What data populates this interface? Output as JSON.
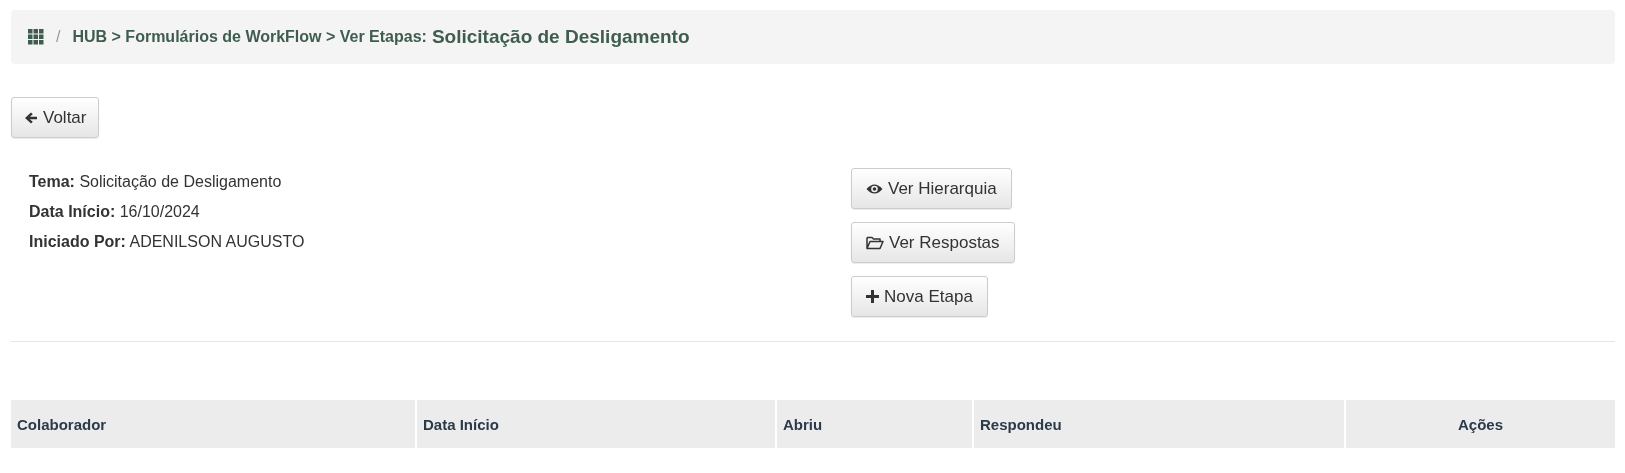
{
  "breadcrumb": {
    "separator": "/",
    "path": "HUB > Formulários de WorkFlow > Ver Etapas:",
    "title": "Solicitação de Desligamento"
  },
  "back_button": {
    "label": "Voltar"
  },
  "info": [
    "**Tema:** Solicitação de Desligamento",
    "**Data Início:** 16/10/2024",
    "**Iniciado Por:** ADENILSON AUGUSTO"
  ],
  "actions": [
    {
      "kind": "eye",
      "label": "Ver Hierarquia"
    },
    {
      "kind": "folder",
      "label": "Ver Respostas"
    },
    {
      "kind": "plus",
      "label": "Nova Etapa"
    }
  ],
  "table": {
    "columns": [
      {
        "label": "Colaborador"
      },
      {
        "label": "Data Início"
      },
      {
        "label": "Abriu"
      },
      {
        "label": "Respondeu"
      },
      {
        "label": "Ações"
      }
    ]
  }
}
